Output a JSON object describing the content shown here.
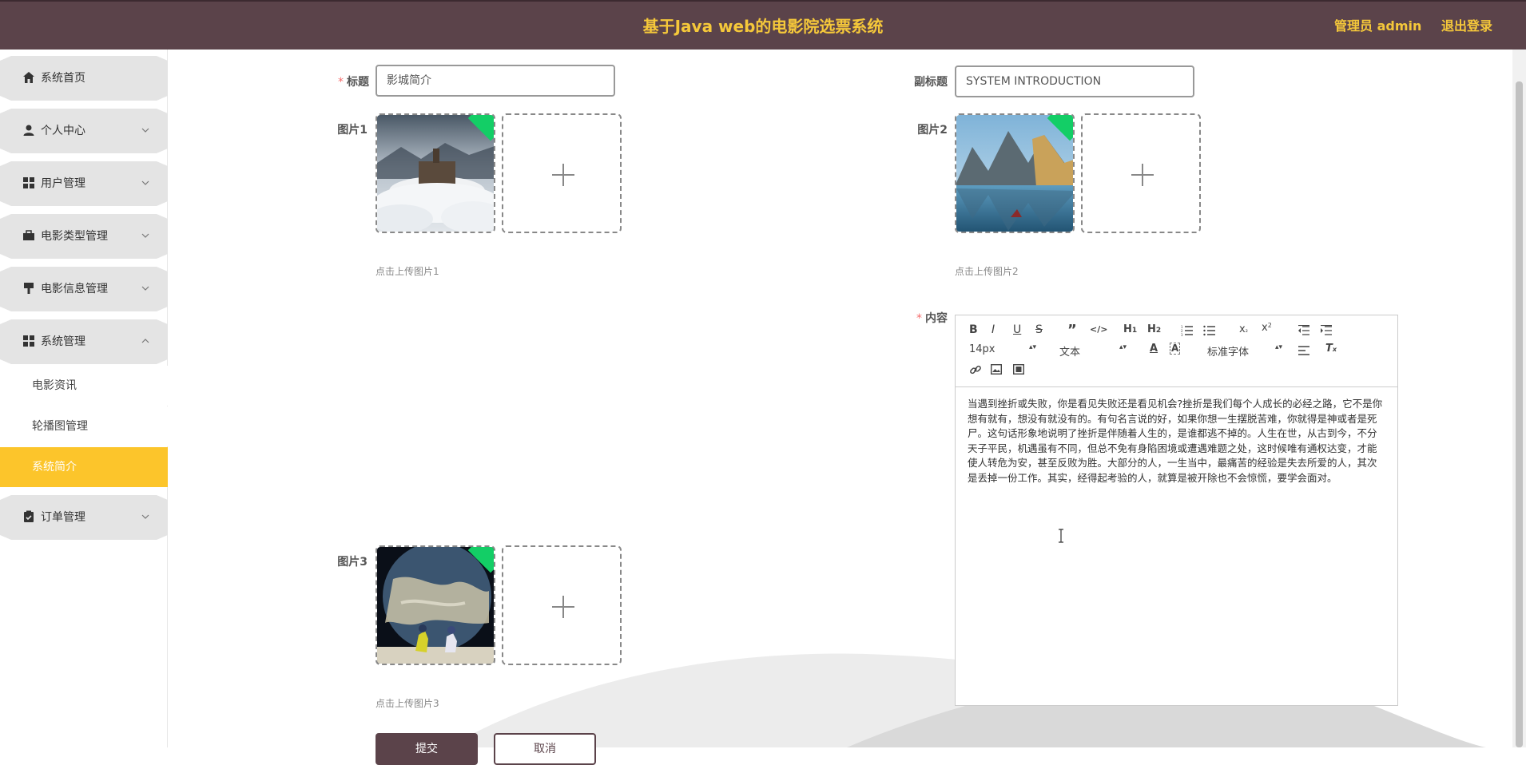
{
  "header": {
    "title": "基于Java web的电影院选票系统",
    "user": "管理员 admin",
    "logout": "退出登录"
  },
  "sidebar": {
    "items": [
      {
        "label": "系统首页",
        "icon": "home-icon"
      },
      {
        "label": "个人中心",
        "icon": "user-icon"
      },
      {
        "label": "用户管理",
        "icon": "grid-icon"
      },
      {
        "label": "电影类型管理",
        "icon": "briefcase-icon"
      },
      {
        "label": "电影信息管理",
        "icon": "brush-icon"
      },
      {
        "label": "系统管理",
        "icon": "grid-icon"
      },
      {
        "label": "订单管理",
        "icon": "clipboard-icon"
      }
    ],
    "subitems": [
      {
        "label": "电影资讯"
      },
      {
        "label": "轮播图管理"
      },
      {
        "label": "系统简介",
        "active": true
      }
    ]
  },
  "form": {
    "title_label": "标题",
    "title_value": "影城简介",
    "subtitle_label": "副标题",
    "subtitle_value": "SYSTEM INTRODUCTION",
    "pic1_label": "图片1",
    "pic1_hint": "点击上传图片1",
    "pic2_label": "图片2",
    "pic2_hint": "点击上传图片2",
    "pic3_label": "图片3",
    "pic3_hint": "点击上传图片3",
    "content_label": "内容",
    "submit": "提交",
    "cancel": "取消"
  },
  "editor": {
    "size_select": "14px",
    "header_select": "文本",
    "font_select": "标准字体",
    "content": "当遇到挫折或失败，你是看见失败还是看见机会?挫折是我们每个人成长的必经之路，它不是你想有就有，想没有就没有的。有句名言说的好，如果你想一生摆脱苦难，你就得是神或者是死尸。这句话形象地说明了挫折是伴随着人生的，是谁都逃不掉的。人生在世，从古到今，不分天子平民，机遇虽有不同，但总不免有身陷困境或遭遇难题之处，这时候唯有通权达变，才能使人转危为安，甚至反败为胜。大部分的人，一生当中，最痛苦的经验是失去所爱的人，其次是丢掉一份工作。其实，经得起考验的人，就算是被开除也不会惊慌，要学会面对。"
  },
  "colors": {
    "header_bg": "#5b434a",
    "accent": "#f5c83a",
    "active_menu": "#fcc52b",
    "required": "#f56c6c"
  }
}
